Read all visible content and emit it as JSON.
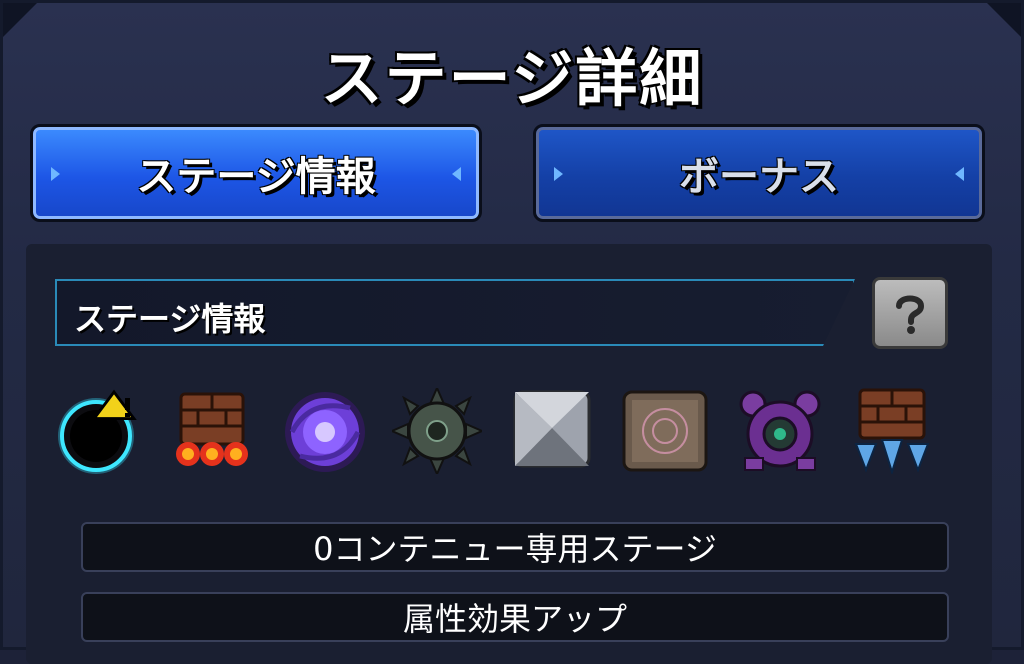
{
  "header": {
    "title": "ステージ詳細"
  },
  "tabs": [
    {
      "label": "ステージ情報",
      "active": true
    },
    {
      "label": "ボーナス",
      "active": false
    }
  ],
  "section": {
    "label": "ステージ情報"
  },
  "gimmicks": [
    {
      "icon": "black-hole-icon"
    },
    {
      "icon": "damage-wall-fire-icon"
    },
    {
      "icon": "warp-vortex-icon"
    },
    {
      "icon": "spiked-mine-icon"
    },
    {
      "icon": "stone-block-icon"
    },
    {
      "icon": "magic-circle-panel-icon"
    },
    {
      "icon": "shield-generator-icon"
    },
    {
      "icon": "damage-wall-ice-icon"
    }
  ],
  "rules": [
    {
      "text": "0コンテニュー専用ステージ"
    },
    {
      "text": "属性効果アップ"
    }
  ],
  "colors": {
    "tab_active": "#1d56e6",
    "tab_inactive": "#1440a6",
    "bar_border": "#2a8ab8",
    "warning": "#f2d21a"
  }
}
